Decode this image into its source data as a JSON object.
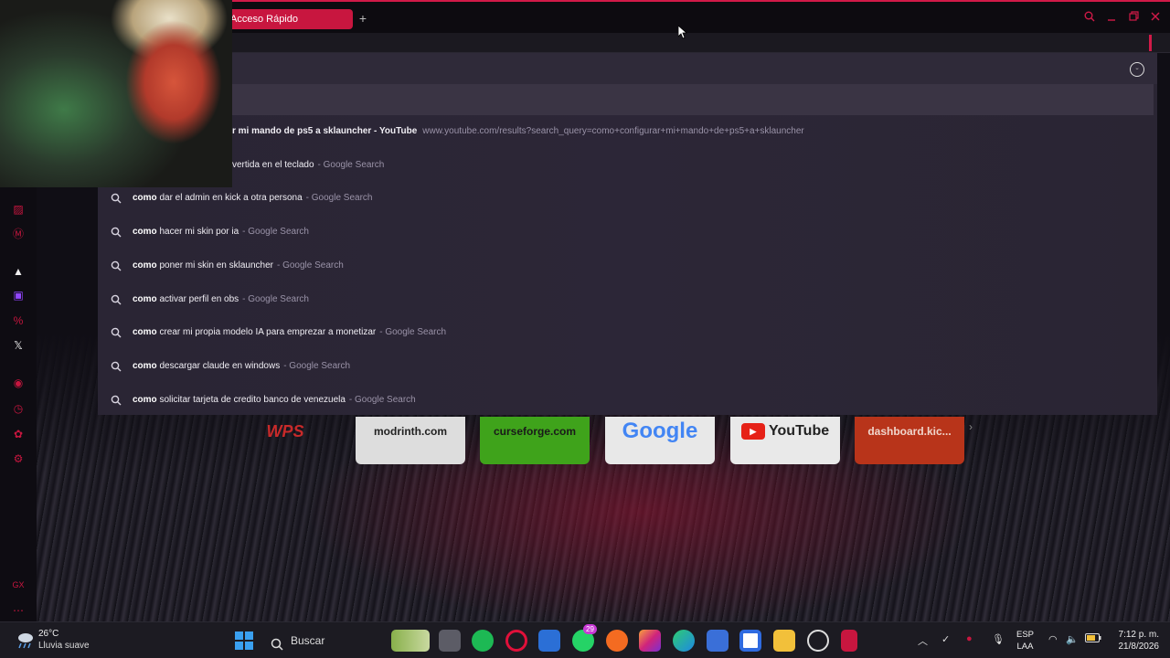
{
  "browser": {
    "active_tab_label": "Acceso Rápido",
    "new_tab_symbol": "+"
  },
  "suggestions": [
    {
      "bold": "",
      "text": "r mi mando de ps5 a sklauncher - YouTube",
      "source": "",
      "url": "www.youtube.com/results?search_query=como+configurar+mi+mando+de+ps5+a+sklauncher"
    },
    {
      "bold": "",
      "text": "vertida en el teclado",
      "source": "- Google Search",
      "url": ""
    },
    {
      "bold": "como",
      "text": " dar el admin en kick a otra persona",
      "source": "- Google Search",
      "url": ""
    },
    {
      "bold": "como",
      "text": " hacer mi skin por ia",
      "source": "- Google Search",
      "url": ""
    },
    {
      "bold": "como",
      "text": " poner mi skin en sklauncher",
      "source": "- Google Search",
      "url": ""
    },
    {
      "bold": "como",
      "text": " activar perfil en obs",
      "source": "- Google Search",
      "url": ""
    },
    {
      "bold": "como",
      "text": " crear mi propia modelo IA para emprezar a monetizar",
      "source": "- Google Search",
      "url": ""
    },
    {
      "bold": "como",
      "text": " descargar claude en windows",
      "source": "- Google Search",
      "url": ""
    },
    {
      "bold": "como",
      "text": " solicitar tarjeta de credito banco de venezuela",
      "source": "- Google Search",
      "url": ""
    }
  ],
  "speed_dial": {
    "wps": "WPS",
    "modrinth": "modrinth.com",
    "curseforge": "curseforge.com",
    "google": "Google",
    "youtube": "YouTube",
    "dashboard": "dashboard.kic..."
  },
  "taskbar": {
    "temperature": "26°C",
    "weather": "Lluvia suave",
    "search_label": "Buscar",
    "whatsapp_badge": "29",
    "lang_primary": "ESP",
    "lang_secondary": "LAA",
    "time": "7:12 p. m.",
    "date": "21/8/2026"
  },
  "colors": {
    "accent": "#d11a48",
    "dropdown_bg": "#2c2637"
  }
}
